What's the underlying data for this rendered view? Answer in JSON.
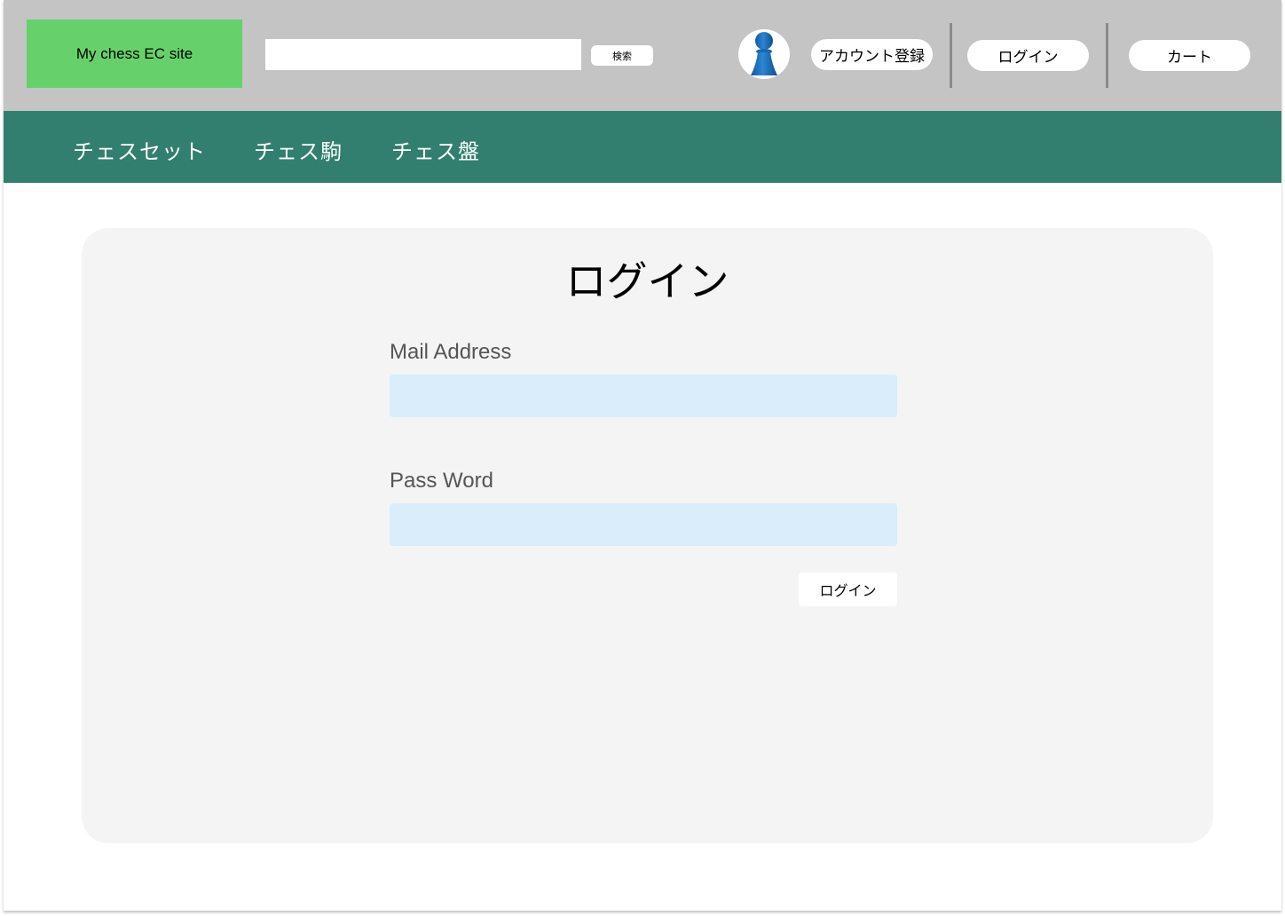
{
  "header": {
    "logo_text": "My chess EC site",
    "search": {
      "value": "",
      "placeholder": "",
      "button_label": "検索"
    },
    "avatar_icon": "user-pawn-icon",
    "register_label": "アカウント登録",
    "login_label": "ログイン",
    "cart_label": "カート"
  },
  "nav": {
    "items": [
      {
        "label": "チェスセット"
      },
      {
        "label": "チェス駒"
      },
      {
        "label": "チェス盤"
      }
    ]
  },
  "login_form": {
    "title": "ログイン",
    "mail_label": "Mail Address",
    "mail_value": "",
    "password_label": "Pass Word",
    "password_value": "",
    "submit_label": "ログイン"
  },
  "colors": {
    "header_bg": "#c4c4c4",
    "logo_bg": "#66d16b",
    "nav_bg": "#337f6f",
    "card_bg": "#f4f4f4",
    "input_bg": "#d9edfa",
    "avatar_blue": "#1f6fbf"
  }
}
